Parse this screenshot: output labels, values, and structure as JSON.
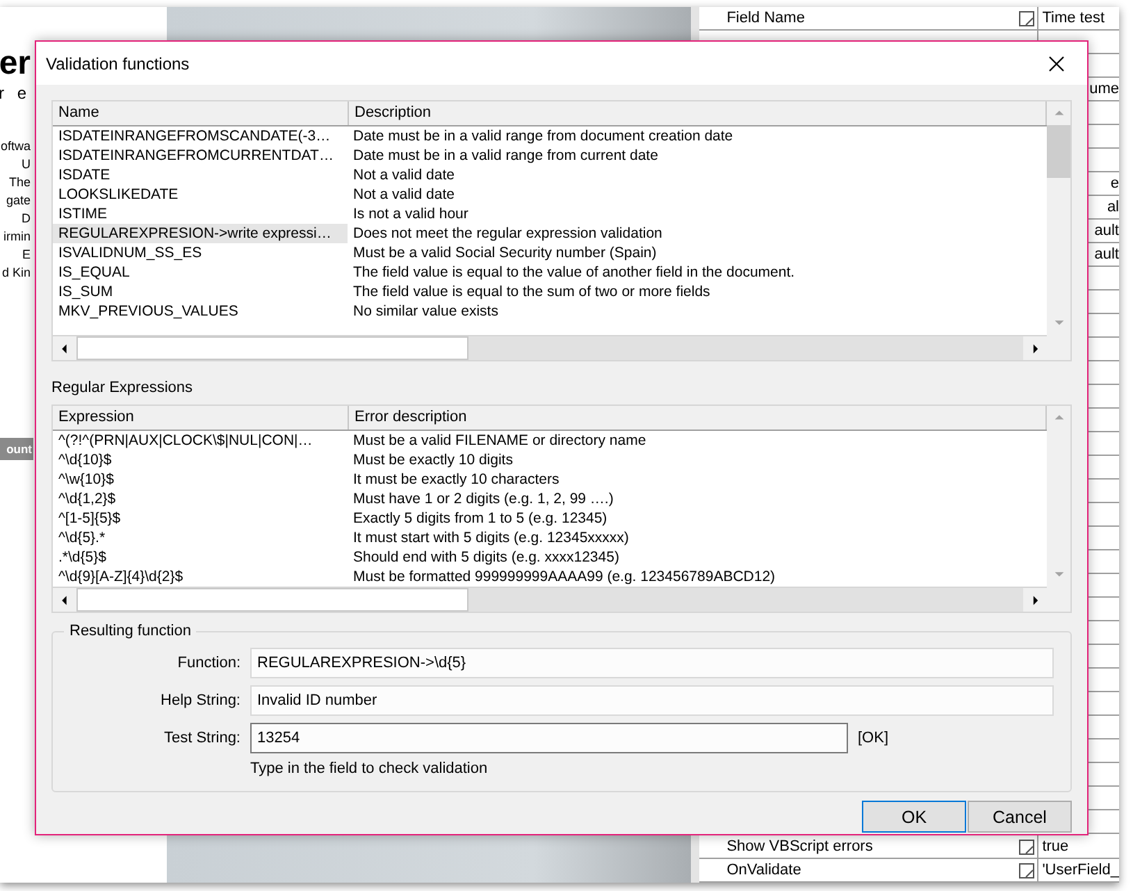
{
  "background": {
    "left_fragments": [
      {
        "text": "er",
        "kind": "logo"
      },
      {
        "text": "r e",
        "kind": "logo-sub"
      },
      {
        "text": "oftwa",
        "kind": "line"
      },
      {
        "text": "U",
        "kind": "line"
      },
      {
        "text": "The",
        "kind": "line"
      },
      {
        "text": "gate",
        "kind": "line"
      },
      {
        "text": "D",
        "kind": "line"
      },
      {
        "text": "irmin",
        "kind": "line"
      },
      {
        "text": "E",
        "kind": "line"
      },
      {
        "text": "d Kin",
        "kind": "line"
      }
    ],
    "table_header": "ount",
    "property_grid": {
      "top_rows": [
        {
          "name": "Field Name",
          "value": "Time test"
        },
        {},
        {},
        {
          "value": "ume"
        },
        {},
        {},
        {},
        {
          "value": "e"
        },
        {
          "value": "al"
        },
        {
          "value": "ault"
        },
        {
          "value": "ault"
        }
      ],
      "bottom_rows": [
        {
          "name": "Show VBScript errors",
          "value": "true"
        },
        {
          "name": "OnValidate",
          "value": "'UserField_"
        }
      ]
    }
  },
  "dialog": {
    "title": "Validation functions",
    "functions": {
      "columns": [
        "Name",
        "Description"
      ],
      "rows": [
        {
          "name": "ISDATEINRANGEFROMSCANDATE(-3…",
          "description": "Date must be in a valid range from document creation date",
          "selected": false
        },
        {
          "name": "ISDATEINRANGEFROMCURRENTDAT…",
          "description": "Date must be in a valid range from current date",
          "selected": false
        },
        {
          "name": "ISDATE",
          "description": "Not a valid date",
          "selected": false
        },
        {
          "name": "LOOKSLIKEDATE",
          "description": "Not a valid date",
          "selected": false
        },
        {
          "name": "ISTIME",
          "description": "Is not a valid hour",
          "selected": false
        },
        {
          "name": "REGULAREXPRESION->write expressi…",
          "description": "Does not meet the regular expression validation",
          "selected": true
        },
        {
          "name": "ISVALIDNUM_SS_ES",
          "description": "Must be a valid Social Security number (Spain)",
          "selected": false
        },
        {
          "name": "IS_EQUAL",
          "description": "The field value is equal to the value of another field in the document.",
          "selected": false
        },
        {
          "name": "IS_SUM",
          "description": "The field value is equal to the sum of two or more fields",
          "selected": false
        },
        {
          "name": "MKV_PREVIOUS_VALUES",
          "description": "No similar value exists",
          "selected": false
        }
      ]
    },
    "regex_label": "Regular Expressions",
    "expressions": {
      "columns": [
        "Expression",
        "Error description"
      ],
      "rows": [
        {
          "expression": "^(?!^(PRN|AUX|CLOCK\\$|NUL|CON|…",
          "description": "Must be a valid FILENAME or directory name"
        },
        {
          "expression": "^\\d{10}$",
          "description": "Must be exactly 10 digits"
        },
        {
          "expression": "^\\w{10}$",
          "description": "It must be exactly 10 characters"
        },
        {
          "expression": "^\\d{1,2}$",
          "description": "Must have 1 or 2 digits (e.g. 1, 2, 99 ….)"
        },
        {
          "expression": "^[1-5]{5}$",
          "description": "Exactly 5 digits from 1 to 5 (e.g. 12345)"
        },
        {
          "expression": "^\\d{5}.*",
          "description": "It must start with 5 digits (e.g. 12345xxxxx)"
        },
        {
          "expression": ".*\\d{5}$",
          "description": "Should end with 5 digits (e.g. xxxx12345)"
        },
        {
          "expression": "^\\d{9}[A-Z]{4}\\d{2}$",
          "description": "Must be formatted 999999999AAAA99 (e.g. 123456789ABCD12)"
        }
      ]
    },
    "result": {
      "legend": "Resulting function",
      "fields": [
        {
          "label": "Function:",
          "value": "REGULAREXPRESION->\\d{5}"
        },
        {
          "label": "Help String:",
          "value": "Invalid ID number"
        },
        {
          "label": "Test String:",
          "value": "13254",
          "status": "[OK]",
          "focused": true
        }
      ],
      "hint": "Type in the field to check validation"
    },
    "buttons": [
      {
        "label": "OK",
        "default": true
      },
      {
        "label": "Cancel",
        "default": false
      }
    ]
  }
}
